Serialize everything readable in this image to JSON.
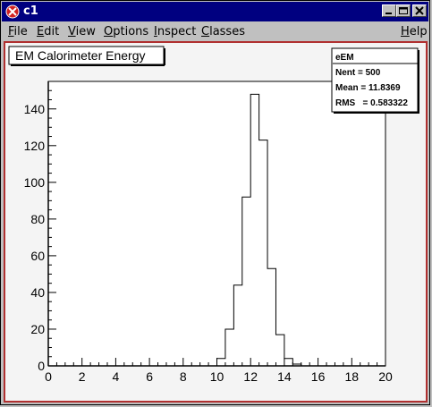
{
  "window": {
    "title": "c1",
    "buttons": [
      "minimize",
      "maximize",
      "close"
    ]
  },
  "menu": {
    "items": [
      "File",
      "Edit",
      "View",
      "Options",
      "Inspect",
      "Classes"
    ],
    "help": "Help"
  },
  "histogram": {
    "title": "EM Calorimeter Energy",
    "stats": {
      "name": "eEM",
      "nent_label": "Nent = 500",
      "mean_label": "Mean  = 11.8369",
      "rms_label": "RMS   = 0.583322"
    }
  },
  "colors": {
    "titlebar": "#000080",
    "canvas_frame": "#b03030",
    "pad_background": "#ffffff"
  },
  "chart_data": {
    "type": "bar",
    "title": "EM Calorimeter Energy",
    "xlim": [
      0,
      20
    ],
    "ylim": [
      0,
      155
    ],
    "x_ticks": [
      "0",
      "2",
      "4",
      "6",
      "8",
      "10",
      "12",
      "14",
      "16",
      "18",
      "20"
    ],
    "y_ticks": [
      "0",
      "20",
      "40",
      "60",
      "80",
      "100",
      "120",
      "140"
    ],
    "bin_width": 0.5,
    "bins": [
      {
        "x": 10.0,
        "count": 4
      },
      {
        "x": 10.5,
        "count": 20
      },
      {
        "x": 11.0,
        "count": 44
      },
      {
        "x": 11.5,
        "count": 92
      },
      {
        "x": 12.0,
        "count": 148
      },
      {
        "x": 12.5,
        "count": 123
      },
      {
        "x": 13.0,
        "count": 53
      },
      {
        "x": 13.5,
        "count": 17
      },
      {
        "x": 14.0,
        "count": 4
      },
      {
        "x": 14.5,
        "count": 1
      }
    ]
  }
}
